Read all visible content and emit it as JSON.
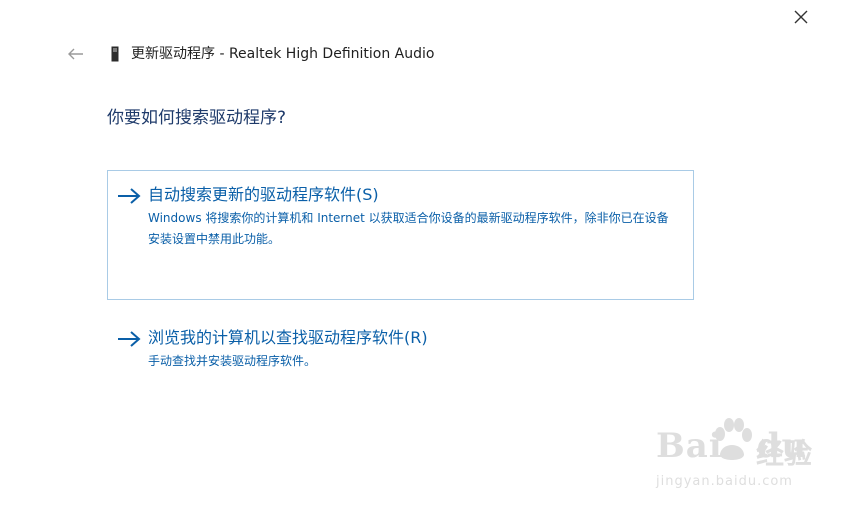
{
  "window": {
    "close_icon": "close-icon",
    "back_icon": "back-arrow-icon"
  },
  "header": {
    "device_icon": "device-icon",
    "title": "更新驱动程序 - Realtek High Definition Audio"
  },
  "question": "你要如何搜索驱动程序?",
  "options": [
    {
      "icon": "arrow-right-icon",
      "title": "自动搜索更新的驱动程序软件(S)",
      "description": "Windows 将搜索你的计算机和 Internet 以获取适合你设备的最新驱动程序软件，除非你已在设备安装设置中禁用此功能。",
      "selected": true
    },
    {
      "icon": "arrow-right-icon",
      "title": "浏览我的计算机以查找驱动程序软件(R)",
      "description": "手动查找并安装驱动程序软件。",
      "selected": false
    }
  ],
  "watermark": {
    "brand": "Bai",
    "brand_suffix": "du",
    "brand_cn": "经验",
    "url": "jingyan.baidu.com"
  },
  "colors": {
    "link_blue": "#0a5fa8",
    "heading_blue": "#1e3a6a",
    "selected_border": "#a9cbe6"
  }
}
